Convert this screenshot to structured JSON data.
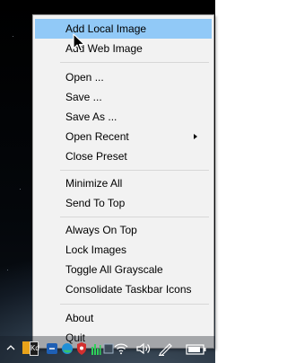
{
  "menu": {
    "items": [
      {
        "label": "Add Local Image"
      },
      {
        "label": "Add Web Image"
      },
      {
        "label": "Open ..."
      },
      {
        "label": "Save ..."
      },
      {
        "label": "Save As ..."
      },
      {
        "label": "Open Recent"
      },
      {
        "label": "Close Preset"
      },
      {
        "label": "Minimize All"
      },
      {
        "label": "Send To Top"
      },
      {
        "label": "Always On Top"
      },
      {
        "label": "Lock Images"
      },
      {
        "label": "Toggle All Grayscale"
      },
      {
        "label": "Consolidate Taskbar Icons"
      },
      {
        "label": "About"
      },
      {
        "label": "Quit"
      }
    ],
    "highlight_color": "#91c9f7",
    "background_color": "#f2f2f2"
  },
  "tray": {
    "icons": [
      "chevron-up-icon",
      "refview-icon",
      "app-icon",
      "edge-icon",
      "antivirus-icon",
      "audio-meter-icon",
      "app-icon-2",
      "wifi-icon",
      "volume-icon",
      "pen-icon",
      "battery-icon"
    ],
    "app_badge_text": "Kd"
  }
}
